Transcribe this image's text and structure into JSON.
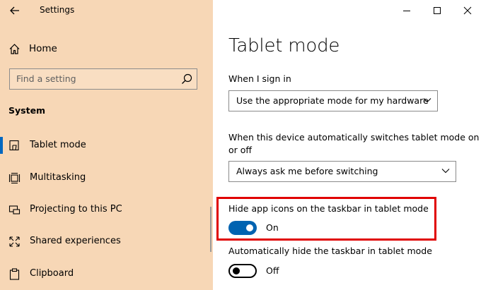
{
  "window": {
    "title": "Settings",
    "controls": [
      "minimize",
      "maximize",
      "close"
    ]
  },
  "sidebar": {
    "home_label": "Home",
    "search_placeholder": "Find a setting",
    "section_heading": "System",
    "items": [
      {
        "label": "Tablet mode",
        "icon": "tablet-mode-icon",
        "active": true
      },
      {
        "label": "Multitasking",
        "icon": "multitasking-icon",
        "active": false
      },
      {
        "label": "Projecting to this PC",
        "icon": "projecting-icon",
        "active": false
      },
      {
        "label": "Shared experiences",
        "icon": "shared-experiences-icon",
        "active": false
      },
      {
        "label": "Clipboard",
        "icon": "clipboard-icon",
        "active": false
      }
    ],
    "background_color": "#f7d7b6",
    "accent_color": "#0067c0"
  },
  "main": {
    "page_title": "Tablet mode",
    "sign_in_label": "When I sign in",
    "sign_in_value": "Use the appropriate mode for my hardware",
    "switch_label_line1": "When this device automatically switches tablet mode on",
    "switch_label_line2": "or off",
    "switch_value": "Always ask me before switching",
    "hide_icons_label": "Hide app icons on the taskbar in tablet mode",
    "hide_icons_state": "On",
    "hide_icons_on": true,
    "hide_taskbar_label": "Automatically hide the taskbar in tablet mode",
    "hide_taskbar_state": "Off",
    "hide_taskbar_on": false,
    "highlight_color": "#e00000",
    "toggle_on_color": "#0063b1"
  }
}
